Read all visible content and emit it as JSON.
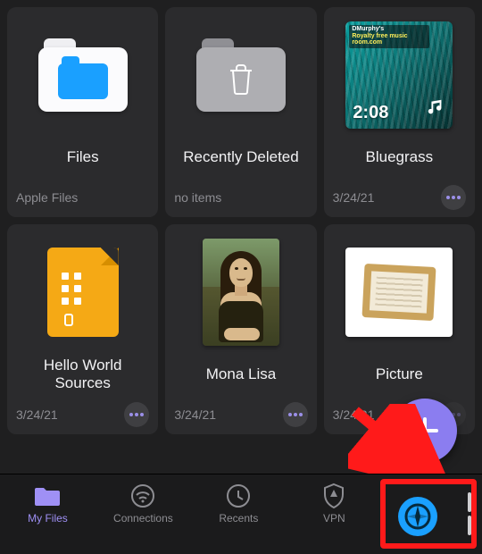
{
  "tiles": [
    {
      "title": "Files",
      "meta": "Apple Files",
      "more": false,
      "thumb": "files"
    },
    {
      "title": "Recently Deleted",
      "meta": "no items",
      "more": false,
      "thumb": "trash"
    },
    {
      "title": "Bluegrass",
      "meta": "3/24/21",
      "more": true,
      "thumb": "album"
    },
    {
      "title": "Hello World Sources",
      "meta": "3/24/21",
      "more": true,
      "thumb": "zip"
    },
    {
      "title": "Mona Lisa",
      "meta": "3/24/21",
      "more": true,
      "thumb": "mona"
    },
    {
      "title": "Picture",
      "meta": "3/24/21",
      "more": true,
      "thumb": "picture"
    }
  ],
  "album": {
    "banner_line1": "DMurphy's",
    "banner_line2": "Royalty free music room.com",
    "duration": "2:08"
  },
  "tabs": [
    {
      "id": "my-files",
      "label": "My Files",
      "active": true
    },
    {
      "id": "connections",
      "label": "Connections",
      "active": false
    },
    {
      "id": "recents",
      "label": "Recents",
      "active": false
    },
    {
      "id": "vpn",
      "label": "VPN",
      "active": false
    }
  ],
  "fab_label": "Add",
  "highlight_target": "browser-tab"
}
